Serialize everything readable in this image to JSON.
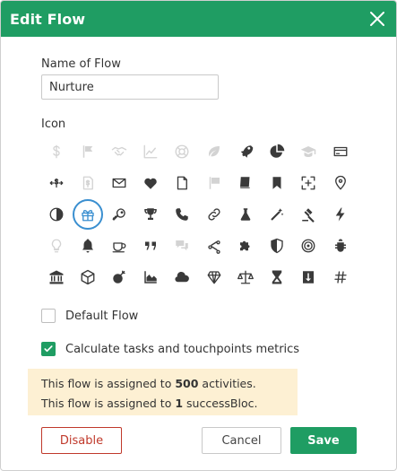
{
  "dialog": {
    "title": "Edit Flow",
    "accent_color": "#1f9d63",
    "selected_ring_color": "#3a8fd0"
  },
  "name_field": {
    "label": "Name of Flow",
    "value": "Nurture"
  },
  "icon_picker": {
    "label": "Icon",
    "selected": "gift-icon",
    "rows": [
      [
        "dollar-icon",
        "flag-icon",
        "handshake-icon",
        "line-chart-icon",
        "life-ring-icon",
        "leaf-icon",
        "rocket-icon",
        "pie-chart-icon",
        "graduation-cap-icon",
        "credit-card-icon"
      ],
      [
        "exchange-dollar-icon",
        "dollar-file-icon",
        "envelope-icon",
        "heart-icon",
        "file-icon",
        "flag-alt-icon",
        "book-icon",
        "bookmark-icon",
        "expand-plus-icon",
        "map-marker-icon"
      ],
      [
        "contrast-icon",
        "gift-icon",
        "key-icon",
        "trophy-icon",
        "phone-icon",
        "link-icon",
        "flask-icon",
        "magic-wand-icon",
        "gavel-icon",
        "bolt-icon"
      ],
      [
        "lightbulb-icon",
        "bell-icon",
        "coffee-icon",
        "quote-icon",
        "comments-icon",
        "share-nodes-icon",
        "puzzle-icon",
        "shield-icon",
        "bullseye-icon",
        "bug-icon"
      ],
      [
        "bank-icon",
        "cube-icon",
        "bomb-icon",
        "area-chart-icon",
        "cloud-icon",
        "diamond-icon",
        "balance-scale-icon",
        "hourglass-icon",
        "download-box-icon",
        "hashtag-icon"
      ]
    ],
    "faded": [
      "dollar-icon",
      "flag-icon",
      "handshake-icon",
      "line-chart-icon",
      "life-ring-icon",
      "leaf-icon",
      "graduation-cap-icon",
      "dollar-file-icon",
      "flag-alt-icon",
      "lightbulb-icon",
      "comments-icon"
    ]
  },
  "options": {
    "default_flow": {
      "label": "Default Flow",
      "checked": false
    },
    "calc_metrics": {
      "label": "Calculate tasks and touchpoints metrics",
      "checked": true
    }
  },
  "notice": {
    "line1_prefix": "This flow is assigned to ",
    "line1_count": "500",
    "line1_suffix": " activities.",
    "line2_prefix": "This flow is assigned to ",
    "line2_count": "1",
    "line2_suffix": " successBloc."
  },
  "buttons": {
    "disable": "Disable",
    "cancel": "Cancel",
    "save": "Save"
  }
}
